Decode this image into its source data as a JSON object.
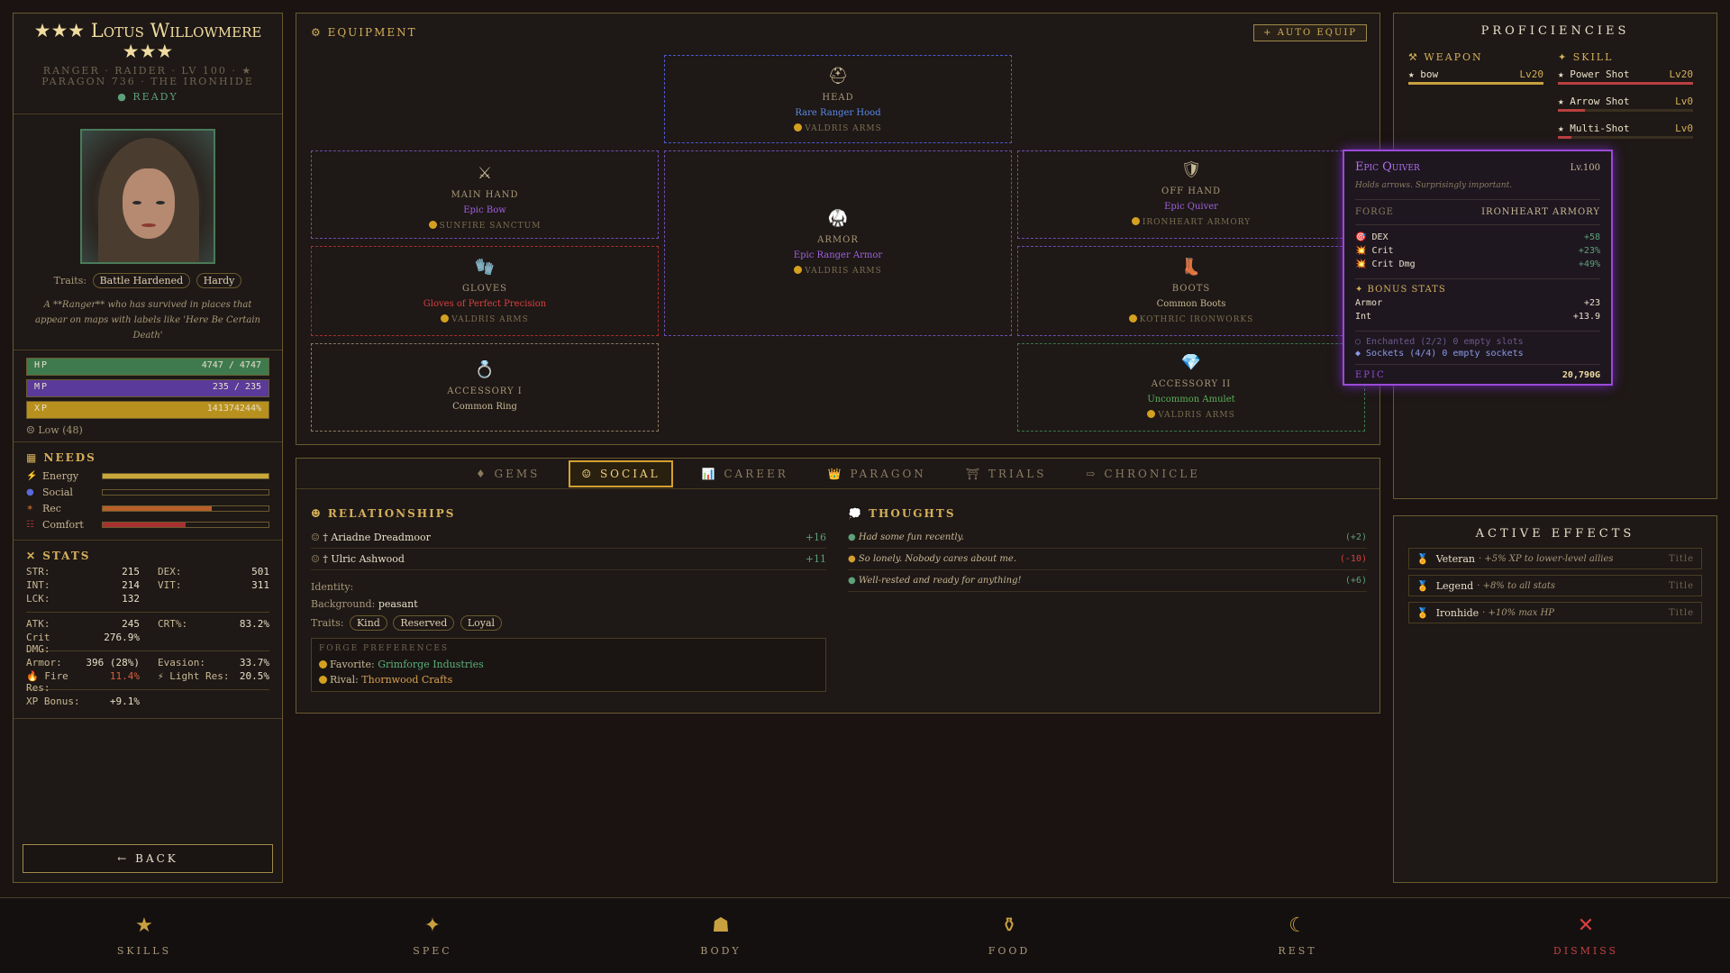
{
  "character": {
    "name": "★★★ Lotus Willowmere ★★★",
    "subtitle": "RANGER · RAIDER · LV 100 · ★ PARAGON 736 · THE IRONHIDE",
    "status": "● READY",
    "traits_label": "Traits:",
    "traits": [
      "Battle Hardened",
      "Hardy"
    ],
    "bio": "A **Ranger** who has survived in places that appear on maps with labels like 'Here Be Certain Death'"
  },
  "vitals": {
    "hp": {
      "label": "HP",
      "value": "4747 / 4747",
      "fraction": 1.0,
      "color": "#3f7a4f"
    },
    "mp": {
      "label": "MP",
      "value": "235 / 235",
      "fraction": 1.0,
      "color": "#5a3a9a"
    },
    "xp": {
      "label": "XP",
      "value": "141374244%",
      "fraction": 1.0,
      "color": "#b8901e"
    },
    "low": "☹ Low (48)"
  },
  "needs": {
    "title": "NEEDS",
    "items": [
      {
        "label": "Energy",
        "fraction": 1.0,
        "color": "#c8a83a"
      },
      {
        "label": "Social",
        "fraction": 0.0,
        "color": "#5a6ad8"
      },
      {
        "label": "Rec",
        "fraction": 0.66,
        "color": "#b8602a"
      },
      {
        "label": "Comfort",
        "fraction": 0.5,
        "color": "#a83030"
      }
    ]
  },
  "stats": {
    "title": "STATS",
    "base": [
      {
        "k": "STR:",
        "v": "215",
        "k2": "DEX:",
        "v2": "501"
      },
      {
        "k": "INT:",
        "v": "214",
        "k2": "VIT:",
        "v2": "311"
      },
      {
        "k": "LCK:",
        "v": "132",
        "k2": "",
        "v2": ""
      }
    ],
    "combat": [
      {
        "k": "ATK:",
        "v": "245",
        "k2": "CRT%:",
        "v2": "83.2%"
      },
      {
        "k": "Crit DMG:",
        "v": "276.9%",
        "k2": "",
        "v2": ""
      }
    ],
    "defense": [
      {
        "k": "Armor:",
        "v": "396 (28%)",
        "k2": "Evasion:",
        "v2": "33.7%"
      },
      {
        "k": "🔥 Fire Res:",
        "v": "11.4%",
        "k2": "⚡ Light Res:",
        "v2": "20.5%"
      }
    ],
    "xp_bonus": {
      "k": "XP Bonus:",
      "v": "+9.1%"
    }
  },
  "back_label": "← BACK",
  "equipment": {
    "title": "⚙ EQUIPMENT",
    "auto_label": "+ AUTO EQUIP",
    "slots": {
      "head": {
        "icon": "⛑",
        "name": "HEAD",
        "item": "Rare Ranger Hood",
        "maker": "VALDRIS ARMS",
        "color": "#5a8ae8"
      },
      "main": {
        "icon": "⚔",
        "name": "MAIN HAND",
        "item": "Epic Bow",
        "maker": "SUNFIRE SANCTUM",
        "color": "#a060e0"
      },
      "armor": {
        "icon": "🥋",
        "name": "ARMOR",
        "item": "Epic Ranger Armor",
        "maker": "VALDRIS ARMS",
        "color": "#a060e0"
      },
      "off": {
        "icon": "🛡",
        "name": "OFF HAND",
        "item": "Epic Quiver",
        "maker": "IRONHEART ARMORY",
        "color": "#a060e0"
      },
      "gloves": {
        "icon": "🧤",
        "name": "GLOVES",
        "item": "Gloves of Perfect Precision",
        "maker": "VALDRIS ARMS",
        "color": "#d84040"
      },
      "boots": {
        "icon": "👢",
        "name": "BOOTS",
        "item": "Common Boots",
        "maker": "KOTHRIC IRONWORKS",
        "color": "#c9b894"
      },
      "acc1": {
        "icon": "💍",
        "name": "ACCESSORY I",
        "item": "Common Ring",
        "maker": "",
        "color": "#c9b894"
      },
      "acc2": {
        "icon": "💎",
        "name": "ACCESSORY II",
        "item": "Uncommon Amulet",
        "maker": "VALDRIS ARMS",
        "color": "#5ab05a"
      }
    }
  },
  "tabs": [
    "♦ GEMS",
    "☺ SOCIAL",
    "📊 CAREER",
    "👑 PARAGON",
    "⛩ TRIALS",
    "⇨ CHRONICLE"
  ],
  "social": {
    "rel_title": "☻ RELATIONSHIPS",
    "relationships": [
      {
        "name": "† Ariadne Dreadmoor",
        "value": "+16"
      },
      {
        "name": "† Ulric Ashwood",
        "value": "+11"
      }
    ],
    "identity_label": "Identity:",
    "background_label": "Background:",
    "background": "peasant",
    "traits_label": "Traits:",
    "traits": [
      "Kind",
      "Reserved",
      "Loyal"
    ],
    "prefs_title": "FORGE PREFERENCES",
    "favorite_label": "Favorite:",
    "favorite": "Grimforge Industries",
    "rival_label": "Rival:",
    "rival": "Thornwood Crafts",
    "thoughts_title": "💭 THOUGHTS",
    "thoughts": [
      {
        "text": "Had some fun recently.",
        "value": "(+2)",
        "color": "#5ea07a"
      },
      {
        "text": "So lonely. Nobody cares about me.",
        "value": "(-10)",
        "color": "#d84040"
      },
      {
        "text": "Well-rested and ready for anything!",
        "value": "(+6)",
        "color": "#5ea07a"
      }
    ]
  },
  "proficiencies": {
    "title": "PROFICIENCIES",
    "weapon_title": "⚒ WEAPON",
    "weapons": [
      {
        "name": "★ bow",
        "lvl": "Lv20",
        "fraction": 1.0
      }
    ],
    "skill_title": "✦ SKILL",
    "skills": [
      {
        "name": "★ Power Shot",
        "lvl": "Lv20",
        "fraction": 1.0
      },
      {
        "name": "★ Arrow Shot",
        "lvl": "Lv0",
        "fraction": 0.2
      },
      {
        "name": "★ Multi-Shot",
        "lvl": "Lv0",
        "fraction": 0.1
      }
    ]
  },
  "tooltip": {
    "name": "Epic Quiver",
    "level": "Lv.100",
    "desc": "Holds arrows. Surprisingly important.",
    "forge_label": "FORGE",
    "forge": "IRONHEART ARMORY",
    "stats": [
      {
        "k": "🎯 DEX",
        "v": "+58"
      },
      {
        "k": "💥 Crit",
        "v": "+23%"
      },
      {
        "k": "💥 Crit Dmg",
        "v": "+49%"
      }
    ],
    "bonus_title": "✦ BONUS STATS",
    "bonus": [
      {
        "k": "Armor",
        "v": "+23"
      },
      {
        "k": "Int",
        "v": "+13.9"
      }
    ],
    "enchanted": "○ Enchanted (2/2) 0 empty slots",
    "sockets": "◆ Sockets (4/4) 0 empty sockets",
    "rarity": "EPIC",
    "price": "20,790G"
  },
  "effects": {
    "title": "ACTIVE EFFECTS",
    "items": [
      {
        "name": "Veteran",
        "desc": "+5% XP to lower-level allies",
        "tag": "Title"
      },
      {
        "name": "Legend",
        "desc": "+8% to all stats",
        "tag": "Title"
      },
      {
        "name": "Ironhide",
        "desc": "+10% max HP",
        "tag": "Title"
      }
    ]
  },
  "nav": [
    {
      "icon": "★",
      "label": "SKILLS"
    },
    {
      "icon": "✦",
      "label": "SPEC"
    },
    {
      "icon": "☗",
      "label": "BODY"
    },
    {
      "icon": "⚱",
      "label": "FOOD"
    },
    {
      "icon": "☾",
      "label": "REST"
    },
    {
      "icon": "✕",
      "label": "DISMISS"
    }
  ]
}
